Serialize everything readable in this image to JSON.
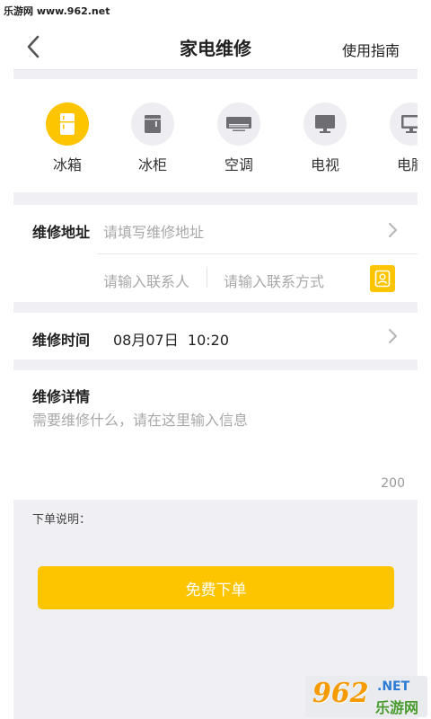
{
  "watermark_top": "乐游网 www.962.net",
  "header": {
    "title": "家电维修",
    "guide_label": "使用指南"
  },
  "categories": [
    {
      "label": "冰箱",
      "icon": "fridge-icon",
      "active": true
    },
    {
      "label": "冰柜",
      "icon": "freezer-icon",
      "active": false
    },
    {
      "label": "空调",
      "icon": "air-conditioner-icon",
      "active": false
    },
    {
      "label": "电视",
      "icon": "tv-icon",
      "active": false
    },
    {
      "label": "电脑",
      "icon": "computer-icon",
      "active": false
    }
  ],
  "address": {
    "label": "维修地址",
    "placeholder": "请填写维修地址",
    "contact_placeholder": "请输入联系人",
    "phone_placeholder": "请输入联系方式"
  },
  "time": {
    "label": "维修时间",
    "value": "08月07日  10:20"
  },
  "detail": {
    "label": "维修详情",
    "placeholder": "需要维修什么，请在这里输入信息",
    "char_limit": "200"
  },
  "order_note": "下单说明：",
  "submit_label": "免费下单",
  "watermark_logo": {
    "number": "962",
    "net": ".NET",
    "cn": "乐游网"
  },
  "colors": {
    "accent": "#fdc400",
    "background": "#f0eff4",
    "placeholder": "#a8a8a8"
  }
}
